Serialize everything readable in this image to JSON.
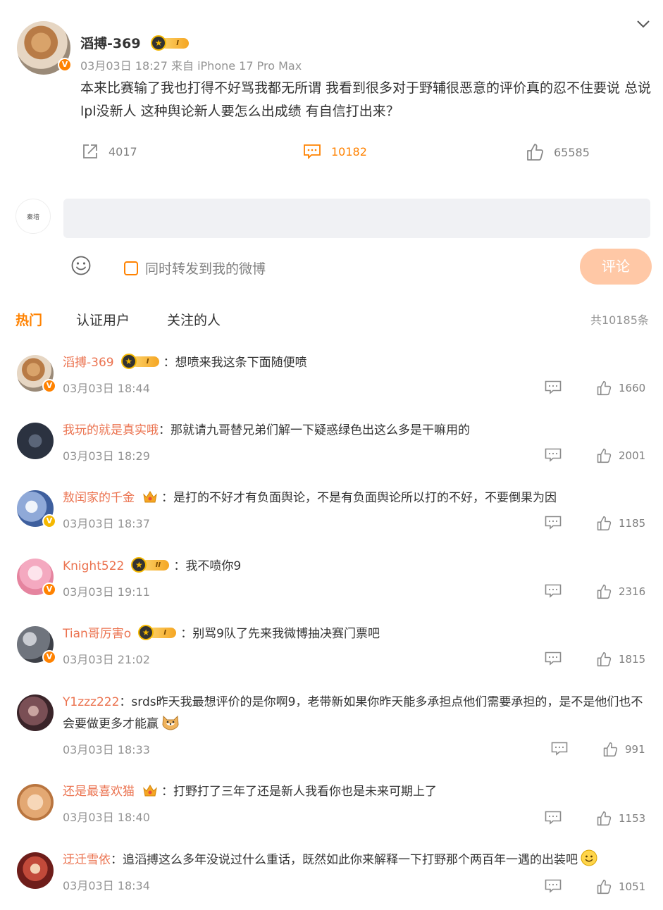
{
  "post": {
    "author": "滔搏-369",
    "level": "I",
    "meta": "03月03日 18:27  来自 iPhone 17 Pro Max",
    "text": "本来比赛输了我也打得不好骂我都无所谓 我看到很多对于野辅很恶意的评价真的忍不住要说 总说lpl没新人 这种舆论新人要怎么出成绩 有自信打出来？",
    "reposts": "4017",
    "comments": "10182",
    "likes": "65585"
  },
  "composer": {
    "avatar_caption": "秦培",
    "placeholder": "",
    "repost_label": "同时转发到我的微博",
    "submit_label": "评论"
  },
  "tabs": [
    {
      "label": "热门",
      "active": true
    },
    {
      "label": "认证用户",
      "active": false
    },
    {
      "label": "关注的人",
      "active": false
    }
  ],
  "total_count": "共10185条",
  "comments": [
    {
      "user": "滔搏-369",
      "badge": "I",
      "sep": "：",
      "text": "想喷来我这条下面随便喷",
      "time": "03月03日 18:44",
      "likes": "1660"
    },
    {
      "user": "我玩的就是真实哦",
      "badge": "",
      "sep": "：",
      "text": "那就请九哥替兄弟们解一下疑惑绿色出这么多是干嘛用的",
      "time": "03月03日 18:29",
      "likes": "2001"
    },
    {
      "user": "敖闰家的千金",
      "badge": "king",
      "sep": "：",
      "text": "是打的不好才有负面舆论，不是有负面舆论所以打的不好，不要倒果为因",
      "time": "03月03日 18:37",
      "likes": "1185"
    },
    {
      "user": "Knight522",
      "badge": "II",
      "sep": "：",
      "text": "我不喷你9",
      "time": "03月03日 19:11",
      "likes": "2316"
    },
    {
      "user": "Tian哥厉害o",
      "badge": "I",
      "sep": "：",
      "text": "别骂9队了先来我微博抽决赛门票吧",
      "time": "03月03日 21:02",
      "likes": "1815"
    },
    {
      "user": "Y1zzz222",
      "badge": "",
      "sep": "：",
      "text": "srds昨天我最想评价的是你啊9，老带新如果你昨天能多承担点他们需要承担的，是不是他们也不会要做更多才能赢",
      "time": "03月03日 18:33",
      "likes": "991"
    },
    {
      "user": "还是最喜欢猫",
      "badge": "king",
      "sep": "：",
      "text": "打野打了三年了还是新人我看你也是未来可期上了",
      "time": "03月03日 18:40",
      "likes": "1153"
    },
    {
      "user": "迂迁雪依",
      "badge": "",
      "sep": "：",
      "text": "追滔搏这么多年没说过什么重话，既然如此你来解释一下打野那个两百年一遇的出装吧",
      "time": "03月03日 18:34",
      "likes": "1051"
    }
  ],
  "colors": {
    "accent": "#ff8200",
    "username": "#eb7350",
    "submit_disabled": "#ffc8a6"
  },
  "icons": [
    "chevron-down-icon",
    "repost-icon",
    "comment-icon",
    "like-icon",
    "emoji-icon",
    "reply-icon",
    "verified-icon",
    "member-crown-icon",
    "king-crown-icon"
  ]
}
